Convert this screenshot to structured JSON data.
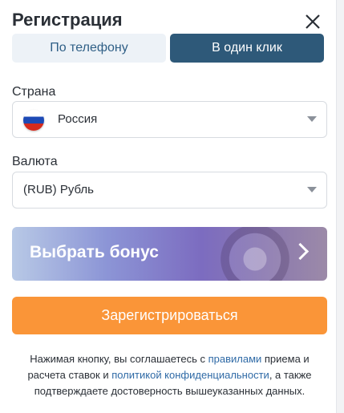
{
  "modal": {
    "title": "Регистрация",
    "close_icon": "close-icon"
  },
  "tabs": [
    {
      "label": "По телефону",
      "active": false
    },
    {
      "label": "В один клик",
      "active": true
    }
  ],
  "country": {
    "label": "Страна",
    "value": "Россия",
    "flag_icon": "russia-flag-icon"
  },
  "currency": {
    "label": "Валюта",
    "value": "(RUB) Рубль"
  },
  "bonus": {
    "label": "Выбрать бонус",
    "icon": "chevron-right-icon"
  },
  "register_button": {
    "label": "Зарегистрироваться",
    "color": "#fa9538"
  },
  "terms": {
    "text_1": "Нажимая кнопку, вы соглашаетесь с ",
    "link_1": "правилами",
    "text_2": " приема и расчета ставок и ",
    "link_2": "политикой конфиденциальности",
    "text_3": ", а также подтверждаете достоверность вышеуказанных данных."
  },
  "colors": {
    "active_tab": "#2e5979",
    "inactive_tab": "#edf2f7",
    "link": "#2f6aa6"
  }
}
